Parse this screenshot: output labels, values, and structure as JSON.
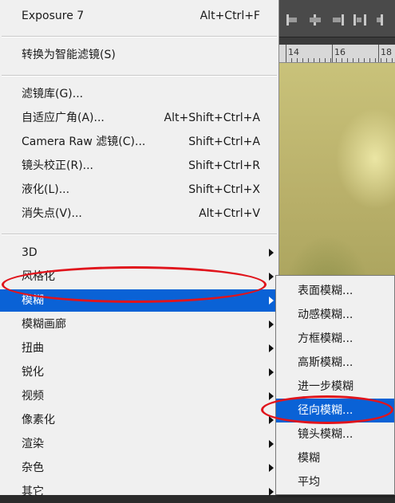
{
  "menu": {
    "items": [
      {
        "label": "Exposure 7",
        "shortcut": "Alt+Ctrl+F",
        "submenu": false
      },
      {
        "separator": true
      },
      {
        "label": "转换为智能滤镜(S)",
        "shortcut": "",
        "submenu": false
      },
      {
        "separator": true
      },
      {
        "label": "滤镜库(G)...",
        "shortcut": "",
        "submenu": false
      },
      {
        "label": "自适应广角(A)...",
        "shortcut": "Alt+Shift+Ctrl+A",
        "submenu": false
      },
      {
        "label": "Camera Raw 滤镜(C)...",
        "shortcut": "Shift+Ctrl+A",
        "submenu": false
      },
      {
        "label": "镜头校正(R)...",
        "shortcut": "Shift+Ctrl+R",
        "submenu": false
      },
      {
        "label": "液化(L)...",
        "shortcut": "Shift+Ctrl+X",
        "submenu": false
      },
      {
        "label": "消失点(V)...",
        "shortcut": "Alt+Ctrl+V",
        "submenu": false
      },
      {
        "separator": true
      },
      {
        "label": "3D",
        "shortcut": "",
        "submenu": true
      },
      {
        "label": "风格化",
        "shortcut": "",
        "submenu": true
      },
      {
        "label": "模糊",
        "shortcut": "",
        "submenu": true,
        "highlighted": true
      },
      {
        "label": "模糊画廊",
        "shortcut": "",
        "submenu": true
      },
      {
        "label": "扭曲",
        "shortcut": "",
        "submenu": true
      },
      {
        "label": "锐化",
        "shortcut": "",
        "submenu": true
      },
      {
        "label": "视频",
        "shortcut": "",
        "submenu": true
      },
      {
        "label": "像素化",
        "shortcut": "",
        "submenu": true
      },
      {
        "label": "渲染",
        "shortcut": "",
        "submenu": true
      },
      {
        "label": "杂色",
        "shortcut": "",
        "submenu": true
      },
      {
        "label": "其它",
        "shortcut": "",
        "submenu": true
      }
    ]
  },
  "submenu": {
    "items": [
      {
        "label": "表面模糊..."
      },
      {
        "label": "动感模糊..."
      },
      {
        "label": "方框模糊..."
      },
      {
        "label": "高斯模糊..."
      },
      {
        "label": "进一步模糊"
      },
      {
        "label": "径向模糊...",
        "highlighted": true
      },
      {
        "label": "镜头模糊..."
      },
      {
        "label": "模糊"
      },
      {
        "label": "平均"
      }
    ]
  },
  "ruler": {
    "labels": [
      "14",
      "16",
      "18"
    ]
  },
  "colors": {
    "highlight": "#0a62d6",
    "annotation": "#e0141c",
    "menu_bg": "#f0f0f0"
  }
}
